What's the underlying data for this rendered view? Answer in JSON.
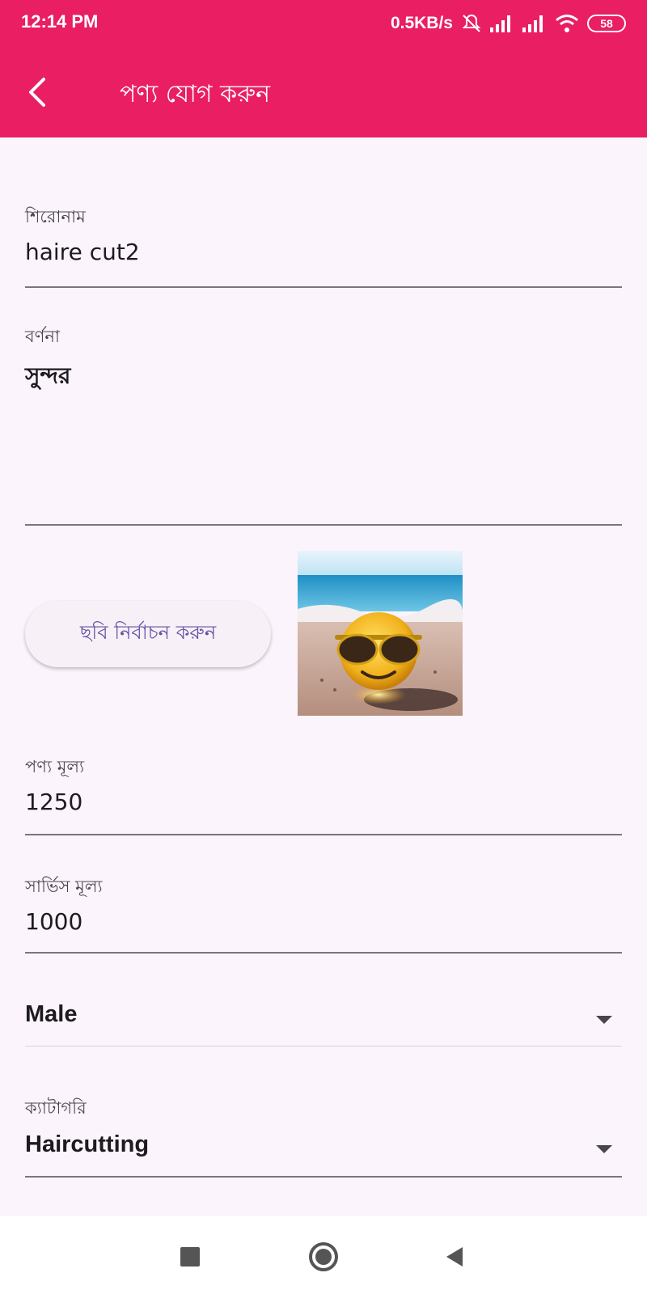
{
  "status_bar": {
    "time": "12:14 PM",
    "network_speed": "0.5KB/s",
    "battery": "58",
    "icons": [
      "mute-icon",
      "signal-icon",
      "signal-icon",
      "wifi-icon",
      "battery-icon"
    ]
  },
  "app_bar": {
    "title": "পণ্য যোগ করুন",
    "back_icon": "chevron-left-icon"
  },
  "form": {
    "title_field": {
      "label": "শিরোনাম",
      "value": "haire cut2"
    },
    "description_field": {
      "label": "বর্ণনা",
      "value": "সুন্দর"
    },
    "pick_image_button": "ছবি নির্বাচন করুন",
    "product_price_field": {
      "label": "পণ্য মূল্য",
      "value": "1250"
    },
    "service_price_field": {
      "label": "সার্ভিস মূল্য",
      "value": "1000"
    },
    "gender_dropdown": {
      "value": "Male"
    },
    "category_dropdown": {
      "label": "ক্যাটাগরি",
      "value": "Haircutting"
    }
  },
  "colors": {
    "primary": "#e91e63",
    "background": "#fcf4fc",
    "button_text": "#6750a4"
  },
  "nav_bar": {
    "icons": [
      "square-icon",
      "circle-home-icon",
      "triangle-back-icon"
    ]
  }
}
